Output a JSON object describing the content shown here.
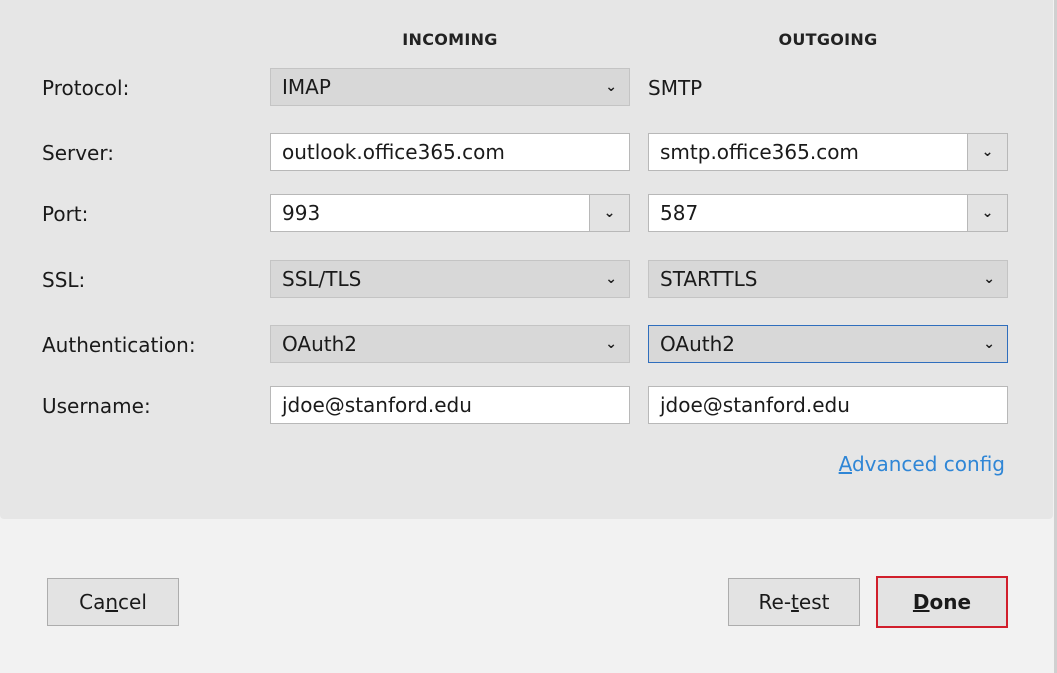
{
  "columns": {
    "incoming": "INCOMING",
    "outgoing": "OUTGOING"
  },
  "rows": {
    "protocol": {
      "label": "Protocol:",
      "incoming": "IMAP",
      "outgoing": "SMTP"
    },
    "server": {
      "label": "Server:",
      "incoming": "outlook.office365.com",
      "outgoing": "smtp.office365.com"
    },
    "port": {
      "label": "Port:",
      "incoming": "993",
      "outgoing": "587"
    },
    "ssl": {
      "label": "SSL:",
      "incoming": "SSL/TLS",
      "outgoing": "STARTTLS"
    },
    "authentication": {
      "label": "Authentication:",
      "incoming": "OAuth2",
      "outgoing": "OAuth2"
    },
    "username": {
      "label": "Username:",
      "incoming": "jdoe@stanford.edu",
      "outgoing": "jdoe@stanford.edu"
    }
  },
  "advanced_link": {
    "underlined": "A",
    "rest": "dvanced config"
  },
  "buttons": {
    "cancel": {
      "pre": "Ca",
      "u": "n",
      "post": "cel"
    },
    "retest": {
      "pre": "Re-",
      "u": "t",
      "post": "est"
    },
    "done": {
      "pre": "",
      "u": "D",
      "post": "one"
    }
  },
  "icons": {
    "dropdown": "chevron-down-icon"
  },
  "colors": {
    "focus_border": "#2f6ebd",
    "default_button_border": "#d11f2c",
    "link": "#2f86d6"
  }
}
